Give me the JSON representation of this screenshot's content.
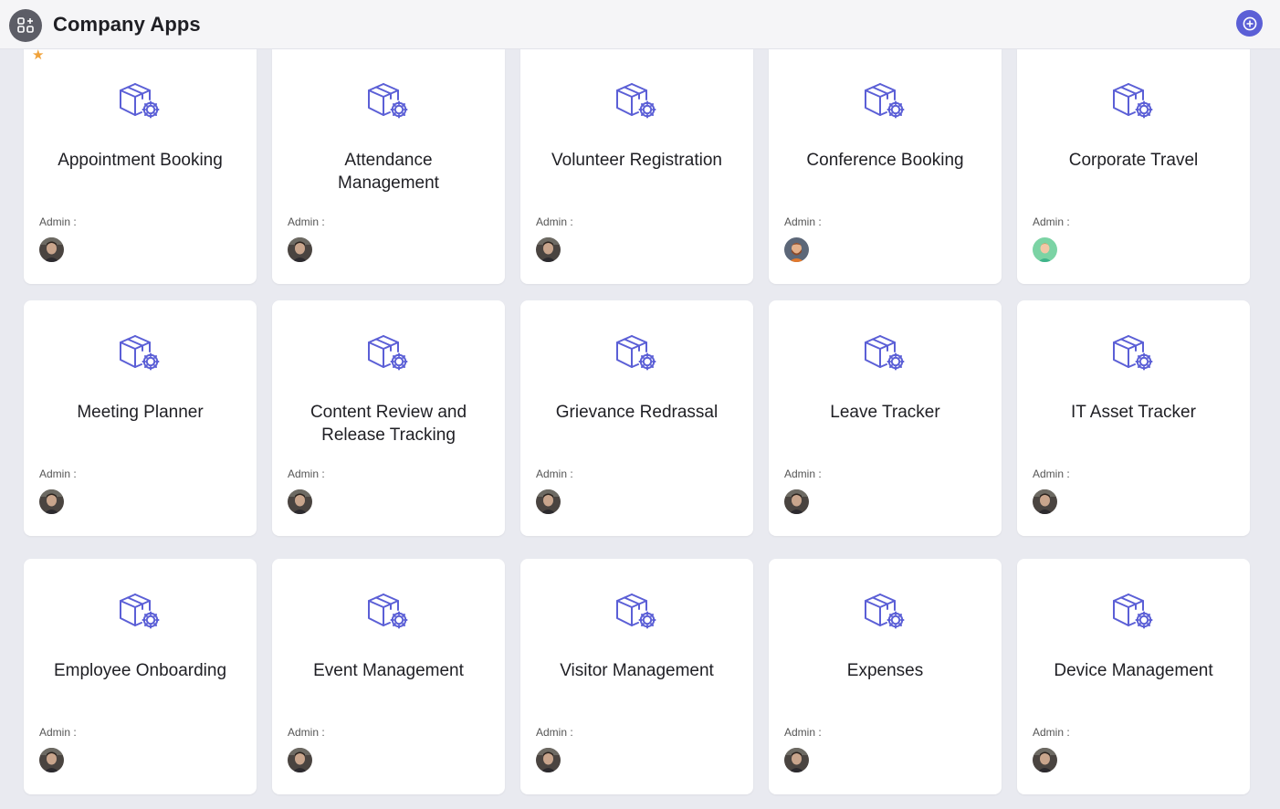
{
  "header": {
    "title": "Company Apps",
    "apps_icon": "grid-apps-icon",
    "add_icon": "plus-icon"
  },
  "colors": {
    "accent": "#5b5fd6",
    "background": "#e9eaf0",
    "card": "#ffffff",
    "favorite": "#f0a23a"
  },
  "admin_label": "Admin :",
  "apps": [
    {
      "name": "Appointment Booking",
      "favorite": true,
      "avatar": "photo"
    },
    {
      "name": "Attendance Management",
      "favorite": false,
      "avatar": "photo"
    },
    {
      "name": "Volunteer Registration",
      "favorite": false,
      "avatar": "photo"
    },
    {
      "name": "Conference Booking",
      "favorite": false,
      "avatar": "beard-illustration"
    },
    {
      "name": "Corporate Travel",
      "favorite": false,
      "avatar": "green-illustration"
    },
    {
      "name": "Meeting Planner",
      "favorite": false,
      "avatar": "photo"
    },
    {
      "name": "Content Review and Release Tracking",
      "favorite": false,
      "avatar": "photo"
    },
    {
      "name": "Grievance Redrassal",
      "favorite": false,
      "avatar": "photo"
    },
    {
      "name": "Leave Tracker",
      "favorite": false,
      "avatar": "photo"
    },
    {
      "name": "IT Asset Tracker",
      "favorite": false,
      "avatar": "photo"
    },
    {
      "name": "Employee Onboarding",
      "favorite": false,
      "avatar": "photo"
    },
    {
      "name": "Event Management",
      "favorite": false,
      "avatar": "photo"
    },
    {
      "name": "Visitor Management",
      "favorite": false,
      "avatar": "photo"
    },
    {
      "name": "Expenses",
      "favorite": false,
      "avatar": "photo"
    },
    {
      "name": "Device Management",
      "favorite": false,
      "avatar": "photo"
    }
  ]
}
